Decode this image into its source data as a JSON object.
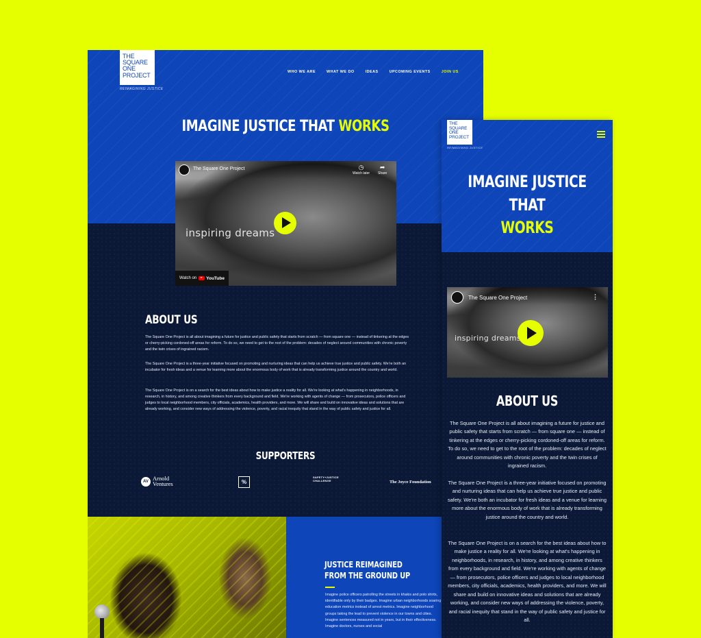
{
  "brand": {
    "logo_lines": [
      "The",
      "Square One",
      "Project"
    ],
    "tagline": "REIMAGINING JUSTICE",
    "accent_color": "#e6ff00",
    "primary_color": "#0e45b8",
    "dark_color": "#0b1937"
  },
  "nav": {
    "items": [
      "WHO WE ARE",
      "WHAT WE DO",
      "IDEAS",
      "UPCOMING EVENTS",
      "JOIN US"
    ]
  },
  "hero": {
    "title_main": "IMAGINE JUSTICE THAT",
    "title_accent": "WORKS"
  },
  "video": {
    "channel_title": "The Square One Project",
    "overlay_text": "inspiring dreams",
    "watch_later": "Watch later",
    "share": "Share",
    "watch_on": "Watch on",
    "youtube": "YouTube"
  },
  "about": {
    "heading": "ABOUT US",
    "p1": "The Square One Project is all about imagining a future for justice and public safety that starts from scratch — from square one — instead of tinkering at the edges or cherry-picking cordoned-off areas for reform. To do so, we need to get to the root of the problem: decades of neglect around communities with chronic poverty and the twin crises of ingrained racism.",
    "p2": "The Square One Project is a three-year initiative focused on promoting and nurturing ideas that can help us achieve true justice and public safety. We're both an incubator for fresh ideas and a venue for learning more about the enormous body of work that is already transforming justice around the country and world.",
    "p3": "The Square One Project is on a search for the best ideas about how to make justice a reality for all. We're looking at what's happening in neighborhoods, in research, in history, and among creative thinkers from every background and field. We're working with agents of change — from prosecutors, police officers and judges to local neighborhood members, city officials, academics, health providers, and more. We will share and build on innovative ideas and solutions that are already working, and consider new ways of addressing the violence, poverty, and racial inequity that stand in the way of public safety and justice for all."
  },
  "supporters": {
    "heading": "SUPPORTERS",
    "arnold_mark": "AV",
    "arnold_line1": "Arnold",
    "arnold_line2": "Ventures",
    "square_mark": "%",
    "safety_text": "SAFETY+JUSTICE CHALLENGE",
    "joyce": "The Joyce Foundation"
  },
  "feature": {
    "heading": "JUSTICE REIMAGINED FROM THE GROUND UP",
    "body": "Imagine police officers patrolling the streets in khakis and polo shirts, identifiable only by their badges. Imagine urban neighborhoods soaring in education metrics instead of arrest metrics. Imagine neighborhood groups taking the lead to prevent violence in our towns and cities. Imagine sentences measured not in years, but in their effectiveness. Imagine doctors, nurses and social"
  }
}
